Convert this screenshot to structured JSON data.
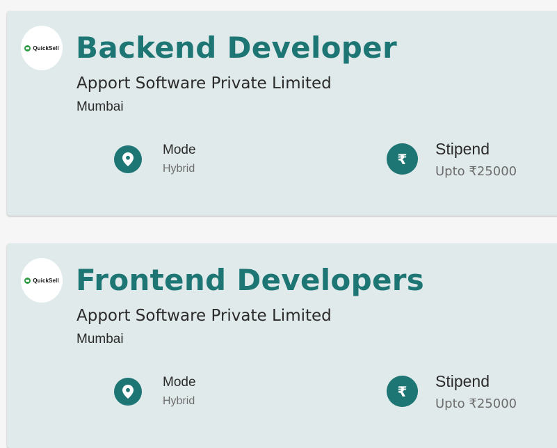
{
  "jobs": [
    {
      "logo_text": "QuickSell",
      "title": "Backend Developer",
      "company": "Apport Software Private Limited",
      "location": "Mumbai",
      "mode_label": "Mode",
      "mode_value": "Hybrid",
      "stipend_label": "Stipend",
      "stipend_value": "Upto ₹25000",
      "rupee_symbol": "₹"
    },
    {
      "logo_text": "QuickSell",
      "title": "Frontend Developers",
      "company": "Apport Software Private Limited",
      "location": "Mumbai",
      "mode_label": "Mode",
      "mode_value": "Hybrid",
      "stipend_label": "Stipend",
      "stipend_value": "Upto ₹25000",
      "rupee_symbol": "₹"
    }
  ],
  "icons": {
    "location": "map-pin-icon",
    "stipend": "rupee-icon",
    "logo": "quicksell-logo"
  },
  "colors": {
    "accent": "#1d7574",
    "card_background": "#e1eaea",
    "page_background": "#f6f6f6",
    "logo_green": "#2e9b44"
  }
}
